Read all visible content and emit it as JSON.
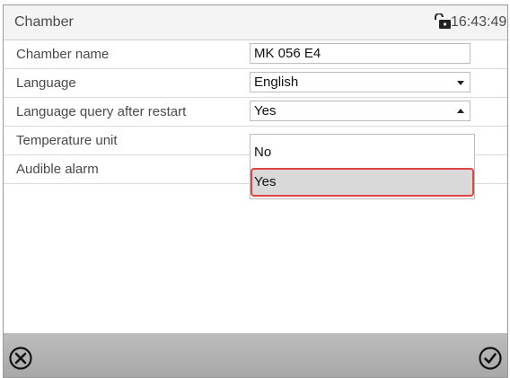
{
  "header": {
    "title": "Chamber",
    "time": "16:43:49",
    "status_icon": "lock-icon"
  },
  "rows": [
    {
      "label": "Chamber name",
      "value": "MK 056 E4"
    },
    {
      "label": "Language",
      "value": "English"
    },
    {
      "label": "Language query after restart",
      "value": "Yes"
    },
    {
      "label": "Temperature unit"
    },
    {
      "label": "Audible alarm"
    }
  ],
  "dropdown": {
    "options": [
      "No",
      "Yes"
    ],
    "selected": "Yes",
    "highlight_color": "#e04545"
  },
  "footer": {
    "cancel_icon": "close-circle-icon",
    "confirm_icon": "check-circle-icon"
  }
}
